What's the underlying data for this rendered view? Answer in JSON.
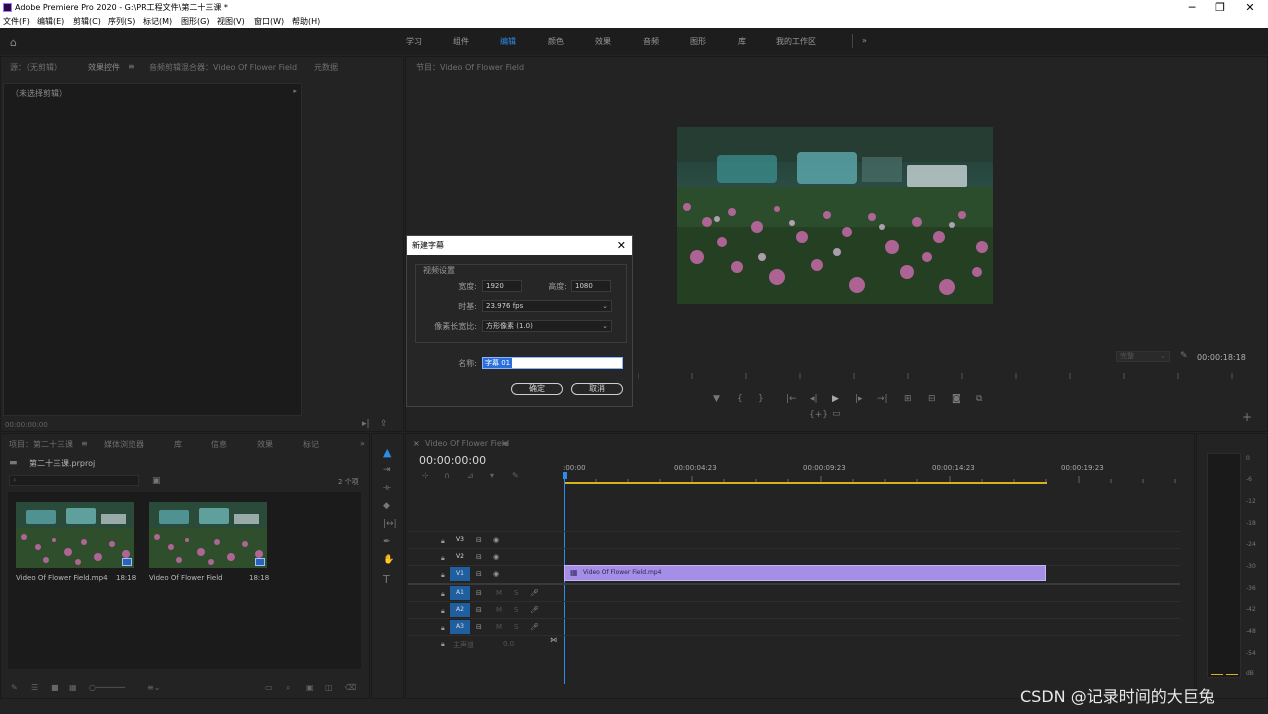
{
  "window": {
    "title": "Adobe Premiere Pro 2020 - G:\\PR工程文件\\第二十三课 *",
    "controls": {
      "minimize": "─",
      "restore": "❐",
      "close": "✕"
    }
  },
  "menu": [
    "文件(F)",
    "编辑(E)",
    "剪辑(C)",
    "序列(S)",
    "标记(M)",
    "图形(G)",
    "视图(V)",
    "窗口(W)",
    "帮助(H)"
  ],
  "workspaces": {
    "items": [
      "学习",
      "组件",
      "编辑",
      "颜色",
      "效果",
      "音频",
      "图形",
      "库",
      "我的工作区"
    ],
    "active": "编辑",
    "more": "»"
  },
  "source_panel": {
    "tabs": [
      "源：（无剪辑）",
      "效果控件",
      "音频剪辑混合器：Video Of Flower Field",
      "元数据"
    ],
    "menu_icon": "≡",
    "no_clip": "（未选择剪辑）",
    "timecode": "00:00:00:00"
  },
  "program_monitor": {
    "tab": "节目：Video Of Flower Field",
    "fit": "完整",
    "timecode": "00:00:18:18"
  },
  "dialog": {
    "title": "新建字幕",
    "section": "视频设置",
    "width_label": "宽度:",
    "width_value": "1920",
    "height_label": "高度:",
    "height_value": "1080",
    "timebase_label": "时基:",
    "timebase_value": "23.976 fps",
    "par_label": "像素长宽比:",
    "par_value": "方形像素 (1.0)",
    "name_label": "名称:",
    "name_value": "字幕 01",
    "ok": "确定",
    "cancel": "取消"
  },
  "project_panel": {
    "tabs": [
      "项目：第二十三课",
      "媒体浏览器",
      "库",
      "信息",
      "效果",
      "标记"
    ],
    "project_file": "第二十三课.prproj",
    "item_count": "2 个项",
    "items": [
      {
        "name": "Video Of Flower Field.mp4",
        "duration": "18:18"
      },
      {
        "name": "Video Of Flower Field",
        "duration": "18:18"
      }
    ]
  },
  "timeline": {
    "tab": "Video Of Flower Field",
    "timecode": "00:00:00:00",
    "ruler": [
      ":00:00",
      "00:00:04:23",
      "00:00:09:23",
      "00:00:14:23",
      "00:00:19:23"
    ],
    "video_tracks": [
      "V3",
      "V2",
      "V1"
    ],
    "audio_tracks": [
      "A1",
      "A2",
      "A3"
    ],
    "master": "主声道",
    "master_value": "0.0",
    "clip": "Video Of Flower Field.mp4",
    "clip_color": "#a58fe6"
  },
  "meter": {
    "labels": [
      "0",
      "-6",
      "-12",
      "-18",
      "-24",
      "-30",
      "-36",
      "-42",
      "-48",
      "-54",
      "dB"
    ]
  },
  "watermark": "CSDN @记录时间的大巨兔"
}
